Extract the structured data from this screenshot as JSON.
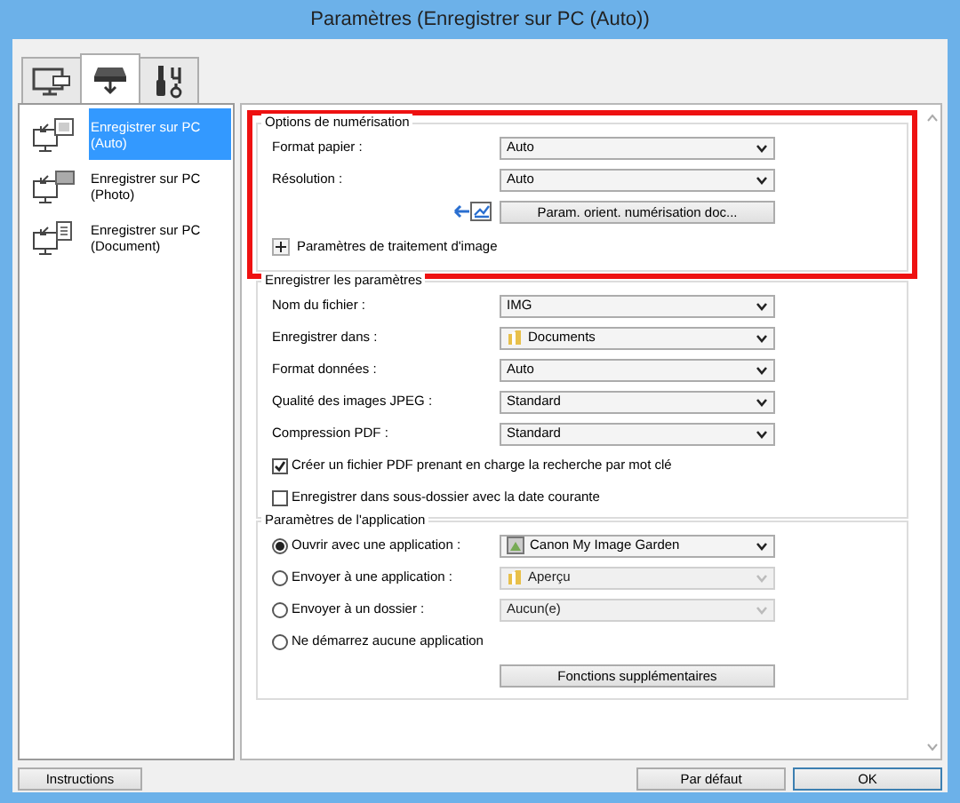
{
  "window": {
    "title": "Paramètres (Enregistrer sur PC (Auto))"
  },
  "tabs": [
    {
      "kind": "computer",
      "selected": false
    },
    {
      "kind": "scanner",
      "selected": true
    },
    {
      "kind": "tools",
      "selected": false
    }
  ],
  "sidebar": {
    "items": [
      {
        "label": "Enregistrer sur PC (Auto)",
        "kind": "auto",
        "selected": true
      },
      {
        "label": "Enregistrer sur PC (Photo)",
        "kind": "photo",
        "selected": false
      },
      {
        "label": "Enregistrer sur PC (Document)",
        "kind": "document",
        "selected": false
      }
    ]
  },
  "sections": [
    {
      "title": "Options de numérisation",
      "highlighted": true,
      "rows": [
        {
          "kind": "select",
          "label": "Format papier :",
          "value": "Auto"
        },
        {
          "kind": "select",
          "label": "Résolution :",
          "value": "Auto"
        },
        {
          "kind": "button",
          "label": "Param. orient. numérisation doc..."
        },
        {
          "kind": "expander",
          "label": "Paramètres de traitement d'image",
          "expanded": false
        }
      ]
    },
    {
      "title": "Enregistrer les paramètres",
      "highlighted": false,
      "rows": [
        {
          "kind": "select",
          "label": "Nom du fichier :",
          "value": "IMG"
        },
        {
          "kind": "select",
          "label": "Enregistrer dans :",
          "value": "Documents"
        },
        {
          "kind": "select",
          "label": "Format données :",
          "value": "Auto"
        },
        {
          "kind": "select",
          "label": "Qualité des images JPEG :",
          "value": "Standard"
        },
        {
          "kind": "select",
          "label": "Compression PDF :",
          "value": "Standard"
        },
        {
          "kind": "checkbox",
          "label": "Créer un fichier PDF prenant en charge la recherche par mot clé",
          "checked": true
        },
        {
          "kind": "checkbox",
          "label": "Enregistrer dans sous-dossier avec la date courante",
          "checked": false
        }
      ]
    },
    {
      "title": "Paramètres de l'application",
      "highlighted": false,
      "rows": [
        {
          "kind": "radio-select",
          "label": "Ouvrir avec une application :",
          "selected": true,
          "value": "Canon My Image Garden",
          "disabled": false
        },
        {
          "kind": "radio-select",
          "label": "Envoyer à une application :",
          "selected": false,
          "value": "Aperçu",
          "disabled": true
        },
        {
          "kind": "radio-select",
          "label": "Envoyer à un dossier :",
          "selected": false,
          "value": "Aucun(e)",
          "disabled": true
        },
        {
          "kind": "radio",
          "label": "Ne démarrez aucune application",
          "selected": false
        },
        {
          "kind": "button",
          "label": "Fonctions supplémentaires"
        }
      ]
    }
  ],
  "footer": {
    "buttons": [
      {
        "label": "Instructions",
        "default": false
      },
      {
        "label": "Par défaut",
        "default": false
      },
      {
        "label": "OK",
        "default": true
      }
    ]
  }
}
